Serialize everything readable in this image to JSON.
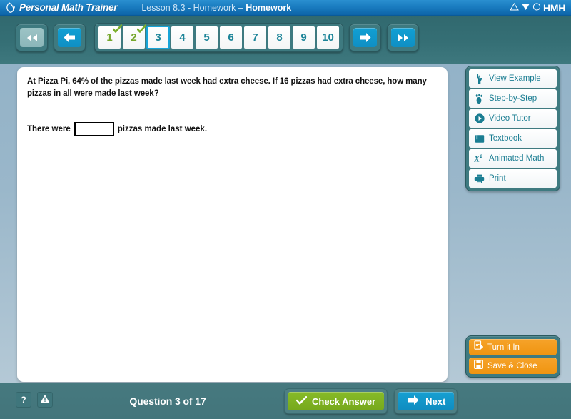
{
  "header": {
    "logo_icon": "pitcher-logo-icon",
    "logo_text": "Personal Math Trainer",
    "lesson_prefix": "Lesson 8.3 - Homework – ",
    "lesson_bold": "Homework",
    "brand_text": "HMH",
    "brand_icons": [
      "triangle-icon",
      "wedge-icon",
      "circle-icon"
    ],
    "colors": {
      "header_blue": "#1a7cc0",
      "teal": "#3e7a80",
      "accent_blue": "#0f8fc4"
    }
  },
  "nav": {
    "first_button": {
      "label": "first-page",
      "icon": "double-chevron-left-icon",
      "enabled": false
    },
    "prev_button": {
      "label": "previous-page",
      "icon": "chevron-left-icon",
      "enabled": true
    },
    "next_button": {
      "label": "next-page",
      "icon": "chevron-right-icon",
      "enabled": true
    },
    "last_button": {
      "label": "last-page",
      "icon": "double-chevron-right-icon",
      "enabled": true
    },
    "pages": [
      {
        "number": "1",
        "state": "done"
      },
      {
        "number": "2",
        "state": "done"
      },
      {
        "number": "3",
        "state": "current"
      },
      {
        "number": "4",
        "state": "todo"
      },
      {
        "number": "5",
        "state": "todo"
      },
      {
        "number": "6",
        "state": "todo"
      },
      {
        "number": "7",
        "state": "todo"
      },
      {
        "number": "8",
        "state": "todo"
      },
      {
        "number": "9",
        "state": "todo"
      },
      {
        "number": "10",
        "state": "todo"
      }
    ]
  },
  "question": {
    "prompt": "At Pizza Pi, 64% of the pizzas made last week had extra cheese. If 16 pizzas had extra cheese, how many pizzas in all were made last week?",
    "answer_prefix": "There were",
    "answer_value": "",
    "answer_placeholder": "",
    "answer_suffix": "pizzas made last week."
  },
  "tools": [
    {
      "label": "View Example",
      "icon": "pointing-hand-icon"
    },
    {
      "label": "Step-by-Step",
      "icon": "footprint-icon"
    },
    {
      "label": "Video Tutor",
      "icon": "play-circle-icon"
    },
    {
      "label": "Textbook",
      "icon": "book-icon"
    },
    {
      "label": "Animated Math",
      "icon": "x-squared-icon"
    },
    {
      "label": "Print",
      "icon": "printer-icon"
    }
  ],
  "submit_actions": [
    {
      "label": "Turn it In",
      "icon": "document-submit-icon"
    },
    {
      "label": "Save & Close",
      "icon": "floppy-disk-icon"
    }
  ],
  "footer": {
    "help_button": {
      "label": "?",
      "icon": "question-mark-icon"
    },
    "alert_button": {
      "label": "!",
      "icon": "warning-triangle-icon"
    },
    "question_counter": "Question 3 of 17",
    "check_answer": {
      "label": "Check Answer",
      "icon": "check-icon"
    },
    "next": {
      "label": "Next",
      "icon": "arrow-right-icon"
    }
  }
}
